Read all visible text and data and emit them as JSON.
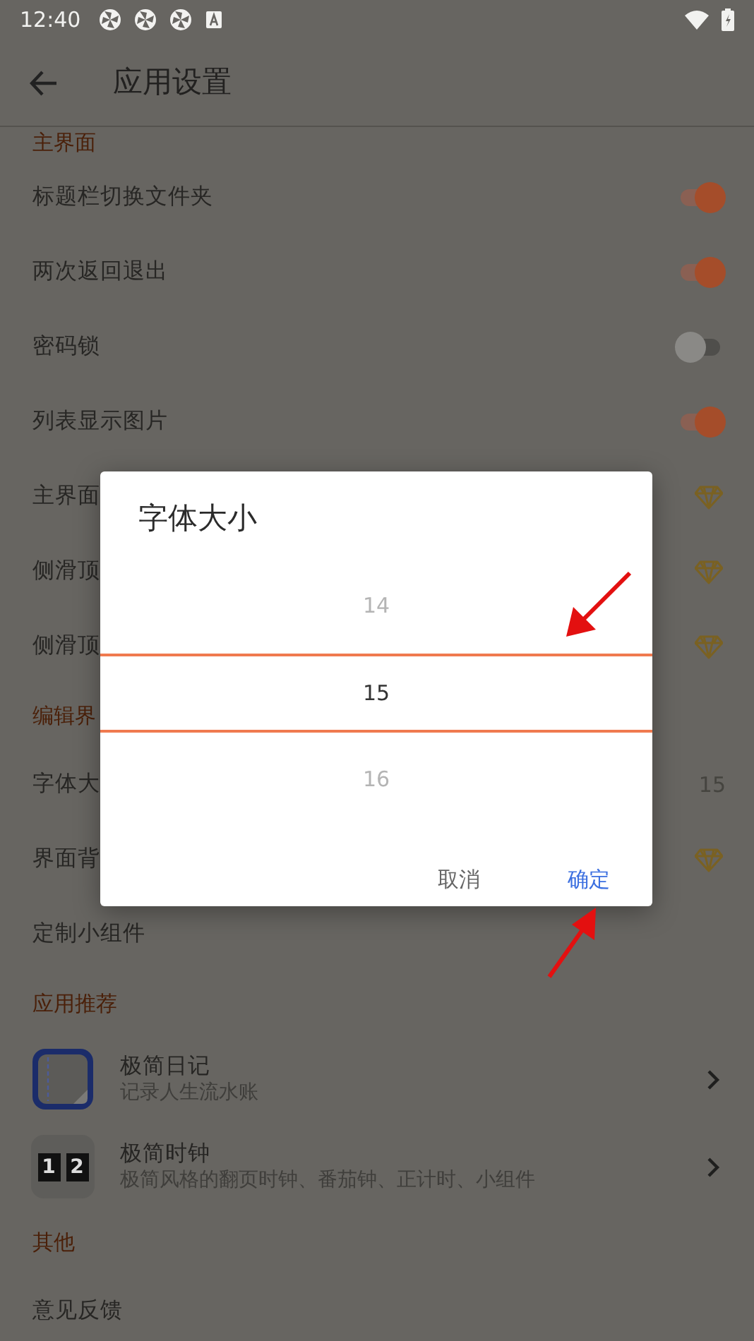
{
  "status_bar": {
    "time": "12:40"
  },
  "toolbar": {
    "title": "应用设置"
  },
  "sections": [
    {
      "header": "主界面",
      "items": [
        {
          "kind": "toggle",
          "label": "标题栏切换文件夹",
          "on": true
        },
        {
          "kind": "toggle",
          "label": "两次返回退出",
          "on": true
        },
        {
          "kind": "toggle",
          "label": "密码锁",
          "on": false
        },
        {
          "kind": "toggle",
          "label": "列表显示图片",
          "on": true
        },
        {
          "kind": "premium",
          "label": "主界面"
        },
        {
          "kind": "premium",
          "label": "侧滑顶"
        },
        {
          "kind": "premium",
          "label": "侧滑顶"
        }
      ]
    },
    {
      "header": "编辑界",
      "items": [
        {
          "kind": "value",
          "label": "字体大",
          "value": "15"
        },
        {
          "kind": "premium",
          "label": "界面背"
        },
        {
          "kind": "plain",
          "label": "定制小组件"
        }
      ]
    },
    {
      "header": "应用推荐",
      "items": [
        {
          "kind": "app",
          "title": "极简日记",
          "subtitle": "记录人生流水账"
        },
        {
          "kind": "app",
          "icon_digits": [
            "1",
            "2"
          ],
          "title": "极简时钟",
          "subtitle": "极简风格的翻页时钟、番茄钟、正计时、小组件"
        }
      ]
    },
    {
      "header": "其他",
      "items": [
        {
          "kind": "plain",
          "label": "意见反馈"
        }
      ]
    }
  ],
  "dialog": {
    "title": "字体大小",
    "options": [
      {
        "label": "14",
        "selected": false
      },
      {
        "label": "15",
        "selected": true
      },
      {
        "label": "16",
        "selected": false
      }
    ],
    "buttons": [
      {
        "label": "取消",
        "kind": "cancel"
      },
      {
        "label": "确定",
        "kind": "confirm"
      }
    ]
  }
}
